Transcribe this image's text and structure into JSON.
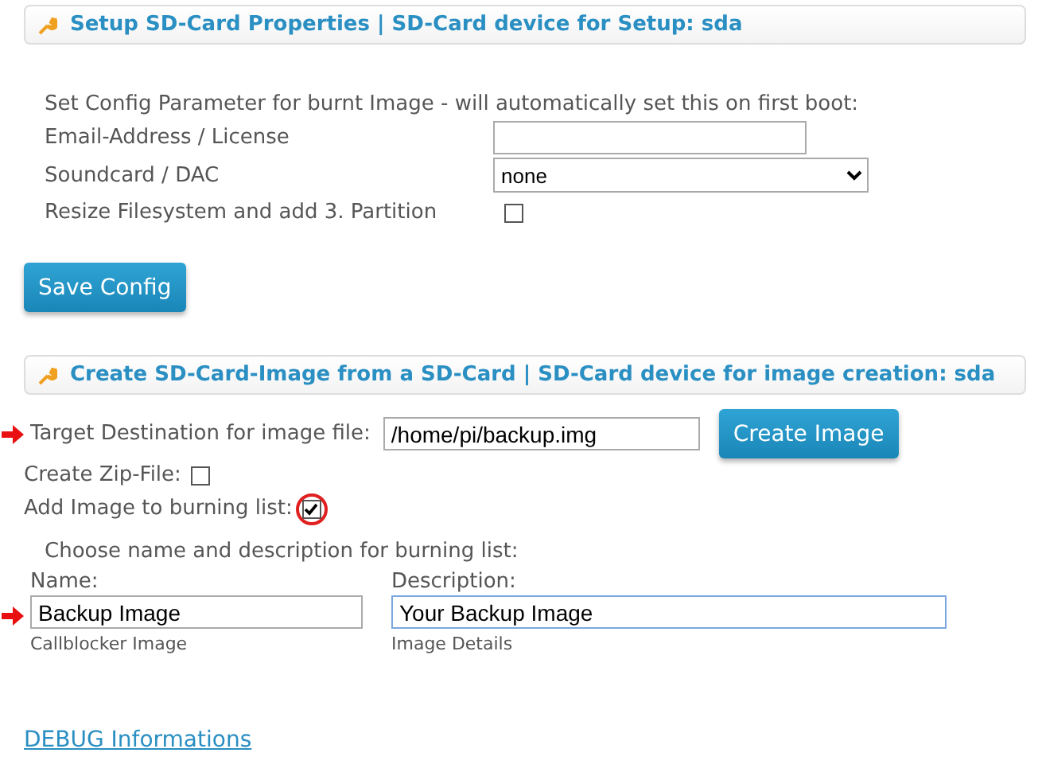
{
  "setup_panel": {
    "title": "Setup SD-Card Properties | SD-Card device for Setup: sda"
  },
  "config": {
    "intro": "Set Config Parameter for burnt Image - will automatically set this on first boot:",
    "email": {
      "label": "Email-Address / License"
    },
    "soundcard": {
      "label": "Soundcard / DAC",
      "value": "none"
    },
    "resize": {
      "label": "Resize Filesystem and add 3. Partition",
      "checked": false
    },
    "save_button": "Save Config"
  },
  "image_panel": {
    "title": "Create SD-Card-Image from a SD-Card | SD-Card device for image creation: sda"
  },
  "image": {
    "target": {
      "label": "Target Destination for image file:",
      "value": "/home/pi/backup.img",
      "marked": true
    },
    "create_button": "Create Image",
    "zip": {
      "label": "Create Zip-File:",
      "checked": false,
      "circled": false
    },
    "burn": {
      "label": "Add Image to burning list:",
      "checked": true,
      "circled": true
    },
    "choose": "Choose name and description for burning list:",
    "name": {
      "label": "Name:",
      "value": "Backup Image",
      "hint": "Callblocker Image",
      "marked": true,
      "focused": false
    },
    "description": {
      "label": "Description:",
      "value": "Your Backup Image",
      "hint": "Image Details",
      "marked": false,
      "focused": true
    }
  },
  "debug_link": "DEBUG Informations"
}
